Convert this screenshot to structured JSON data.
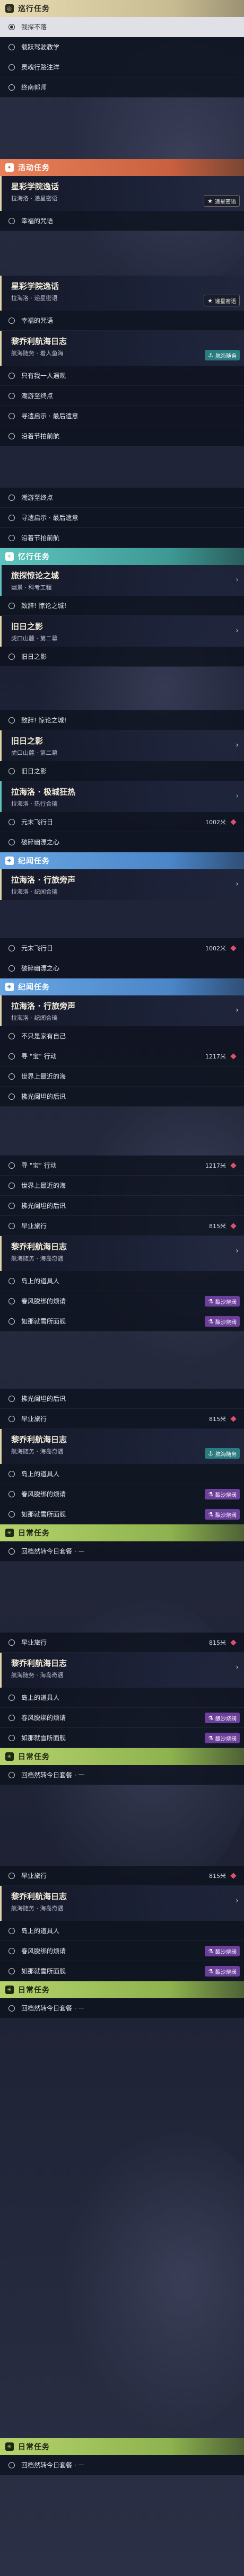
{
  "cat_tour": "巡行任务",
  "cat_event": "活动任务",
  "cat_dreamer": "忆行任务",
  "cat_history": "纪闻任务",
  "cat_daily": "日常任务",
  "q_star_title": "星彩学院逸话",
  "q_star_sub": "拉海洛 · 递星密语",
  "q_nav_title": "黎乔利航海日志",
  "q_nav_sub_a": "航海随务 · 着人鱼海",
  "q_nav_sub_b": "航海随务 · 海岛奇遇",
  "q_dream_title": "旅探惊论之城",
  "q_dream_sub": "幽景 · 科考工程",
  "q_old_title": "旧日之影",
  "q_old_sub": "虎口山麓 · 第二幕",
  "q_rush_title": "拉海洛 · 极城狂热",
  "q_rush_sub": "拉海洛 · 热行合璃",
  "q_tourist_title": "拉海洛 · 行旅旁声",
  "q_tourist_sub": "拉海洛 · 纪闻合璃",
  "t_gather": "我探不落",
  "t_drive": "载跃驾驶教学",
  "t_clouds": "灵魂行路注洋",
  "t_sleep": "终南郭师",
  "t_lucky": "幸福的咒语",
  "t_people": "只有我一人遇观",
  "t_wave": "潮游至终点",
  "t_seek": "寻遗启示 · 最后遗意",
  "t_port": "沿着节拍前航",
  "t_clue": "致辞! 惊论之城!",
  "t_oldshadow": "旧日之影",
  "t_fly": "元末飞行日",
  "t_heart": "破碎幽漂之心",
  "t_unafraid": "不只是家有自己",
  "t_search": "寻 \"宝\" 行动",
  "t_odd_sea": "世界上最近的海",
  "t_cold_road": "拂光阑坦的后讯",
  "t_early": "早业旅行",
  "t_islander": "岛上的道具人",
  "t_spring": "春风脱绑的烦请",
  "t_wait": "如那就雪所面舰",
  "t_daily": "回档然转今日套餐 · 一",
  "d_1002": "1002米",
  "d_1217": "1217米",
  "d_815": "815米",
  "tag_star": "递星密语",
  "tag_nav": "航海随务",
  "tag_brew": "酿沙烧阀",
  "c_gold": "#e0d4a8",
  "c_teal": "#5ec4bf",
  "c_event": "#c9603f",
  "c_history": "#4a86c8",
  "c_daily": "#8db24e",
  "c_diamond": "#e05068"
}
